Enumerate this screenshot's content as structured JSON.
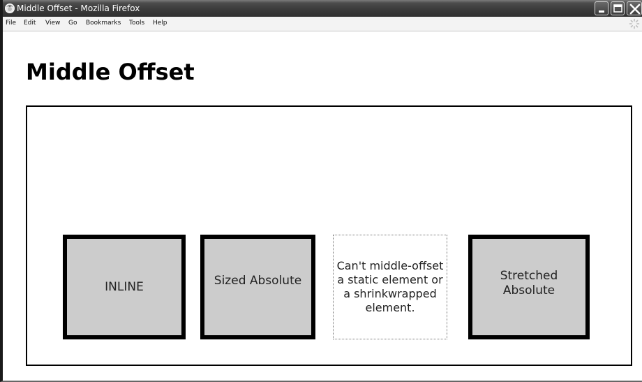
{
  "window": {
    "title": "Middle Offset - Mozilla Firefox"
  },
  "menu": {
    "items": [
      "File",
      "Edit",
      "View",
      "Go",
      "Bookmarks",
      "Tools",
      "Help"
    ]
  },
  "page": {
    "heading": "Middle Offset",
    "boxes": [
      {
        "label": "INLINE"
      },
      {
        "label": "Sized Absolute"
      },
      {
        "label": "Can't middle-offset a static element or a shrinkwrapped element."
      },
      {
        "label": "Stretched Absolute"
      }
    ]
  },
  "colors": {
    "box_fill": "#cccccc",
    "box_border": "#000000",
    "titlebar": "#3b3b3b"
  }
}
